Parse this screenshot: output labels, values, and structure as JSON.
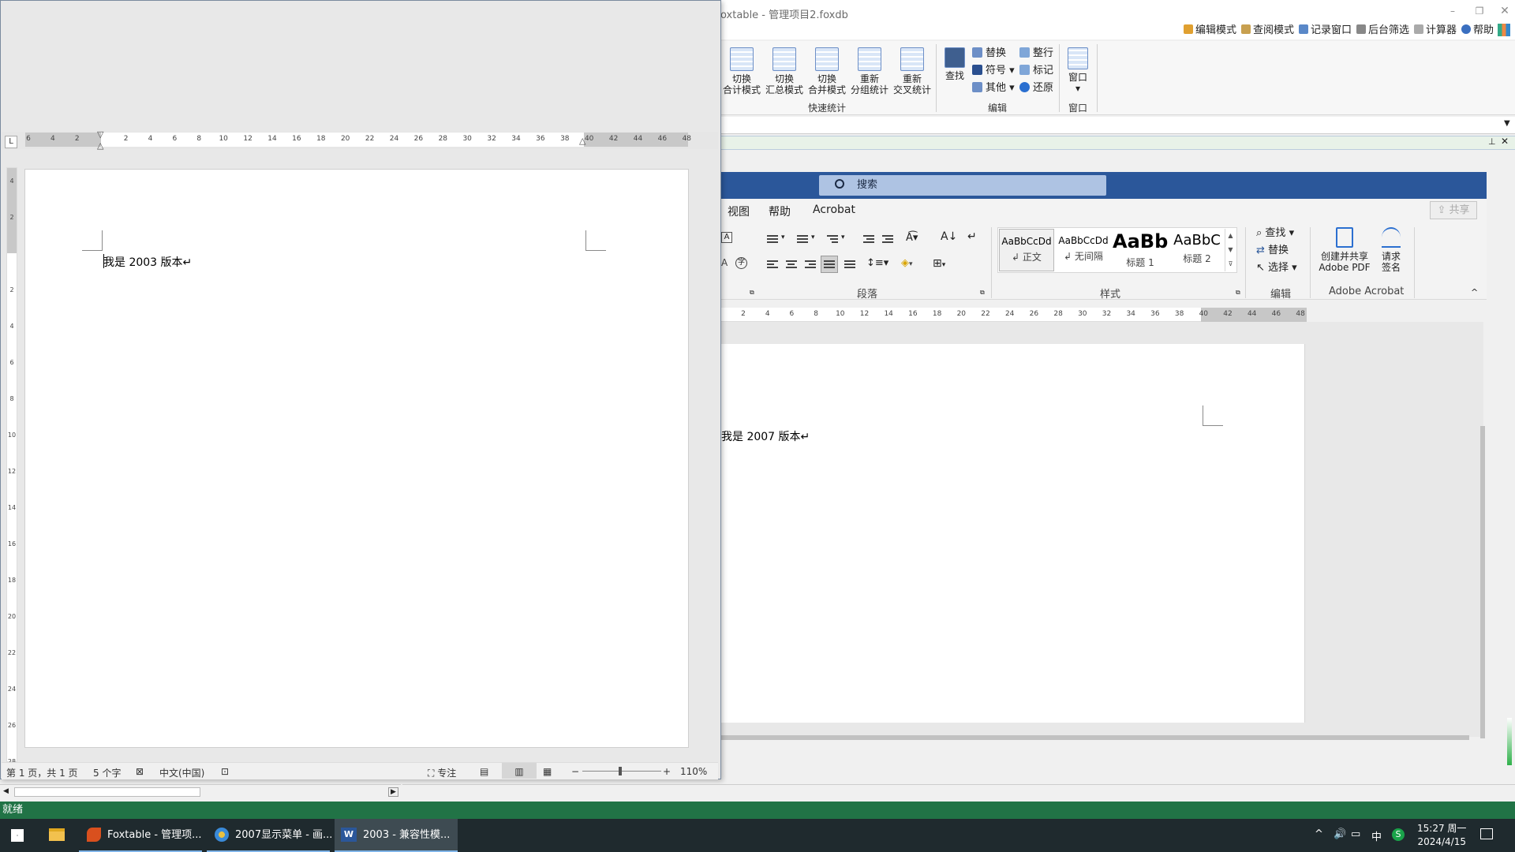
{
  "foxtable": {
    "title": "oxtable - 管理项目2.foxdb",
    "toolbar": [
      "编辑模式",
      "查阅模式",
      "记录窗口",
      "后台筛选",
      "计算器",
      "帮助"
    ],
    "ribbon": {
      "quick_stats": [
        "切换\n合计模式",
        "切换\n汇总模式",
        "切换\n合并模式",
        "重新\n分组统计",
        "重新\n交叉统计"
      ],
      "quick_stats_group": "快速统计",
      "find": "查找",
      "edit_small": [
        "替换",
        "符号",
        "其他",
        "整行",
        "标记",
        "还原"
      ],
      "edit_group": "编辑",
      "window": "窗口",
      "window_group": "窗口"
    },
    "status": "就绪"
  },
  "word2007": {
    "search": "搜索",
    "tabs": [
      "视图",
      "帮助",
      "Acrobat"
    ],
    "share": "共享",
    "styles": [
      {
        "preview": "AaBbCcDd",
        "name": "正文"
      },
      {
        "preview": "AaBbCcDd",
        "name": "无间隔"
      },
      {
        "preview": "AaBb",
        "name": "标题 1"
      },
      {
        "preview": "AaBbC",
        "name": "标题 2"
      }
    ],
    "edit_items": [
      "查找",
      "替换",
      "选择"
    ],
    "acrobat_items": [
      "创建并共享\nAdobe PDF",
      "请求\n签名"
    ],
    "groups": [
      "段落",
      "样式",
      "编辑",
      "Adobe Acrobat"
    ],
    "ruler_ticks": [
      "2",
      "4",
      "6",
      "8",
      "10",
      "12",
      "14",
      "16",
      "18",
      "20",
      "22",
      "24",
      "26",
      "28",
      "30",
      "32",
      "34",
      "36",
      "38",
      "40",
      "42",
      "44",
      "46",
      "48"
    ],
    "doc_text": "我是 2007 版本↵"
  },
  "word2003": {
    "ruler_ticks": [
      "6",
      "4",
      "2",
      "",
      "2",
      "4",
      "6",
      "8",
      "10",
      "12",
      "14",
      "16",
      "18",
      "20",
      "22",
      "24",
      "26",
      "28",
      "30",
      "32",
      "34",
      "36",
      "38",
      "40",
      "42",
      "44",
      "46",
      "48"
    ],
    "vruler_ticks": [
      "4",
      "2",
      "",
      "2",
      "4",
      "6",
      "8",
      "10",
      "12",
      "14",
      "16",
      "18",
      "20",
      "22",
      "24",
      "26",
      "28"
    ],
    "doc_text": "我是 2003 版本↵",
    "status": {
      "page": "第 1 页，共 1 页",
      "words": "5 个字",
      "language": "中文(中国)",
      "focus": "专注",
      "zoom": "110%"
    }
  },
  "taskbar": {
    "apps": [
      "Foxtable - 管理项...",
      "2007显示菜单 - 画...",
      "2003  -  兼容性模..."
    ],
    "time": "15:27 周一",
    "date": "2024/4/15",
    "ime": "中"
  }
}
